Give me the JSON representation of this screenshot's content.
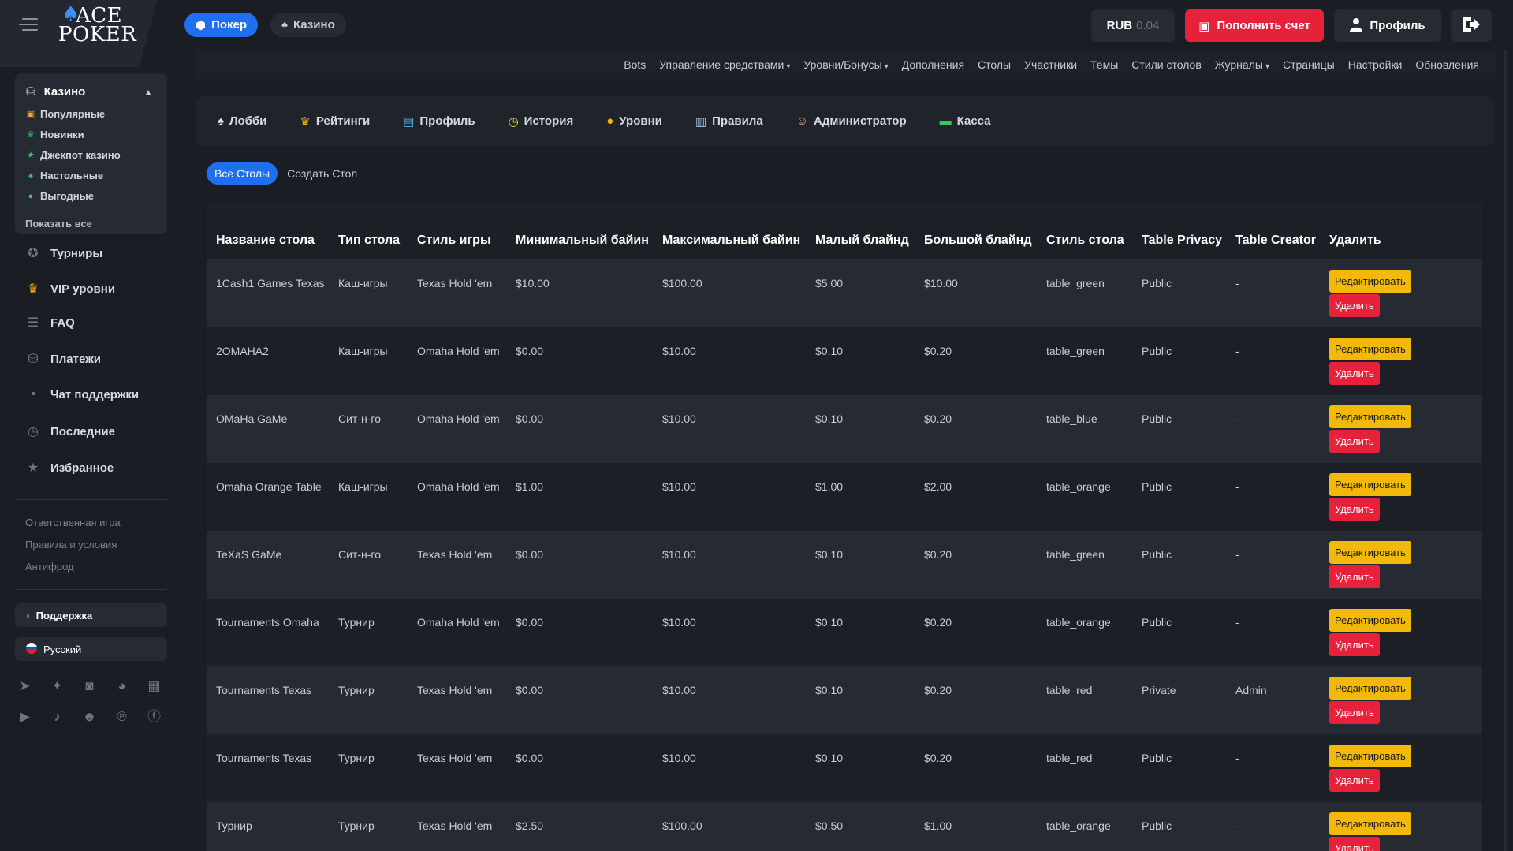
{
  "header": {
    "logo_line1": "ACE",
    "logo_line2": "POKER",
    "nav_poker": "Покер",
    "nav_casino": "Казино",
    "balance_currency": "RUB",
    "balance_amount": "0.04",
    "deposit_label": "Пополнить счет",
    "profile_label": "Профиль"
  },
  "admin_nav": [
    "Bots",
    "Управление средствами",
    "Уровни/Бонусы",
    "Дополнения",
    "Столы",
    "Участники",
    "Темы",
    "Стили столов",
    "Журналы",
    "Страницы",
    "Настройки",
    "Обновления"
  ],
  "sidebar": {
    "casino_title": "Казино",
    "casino_items": [
      {
        "label": "Популярные",
        "icon": "fire-icon",
        "color": "#f5a623"
      },
      {
        "label": "Новинки",
        "icon": "trophy-icon",
        "color": "#30c95a"
      },
      {
        "label": "Джекпот казино",
        "icon": "star-icon",
        "color": "#30c95a"
      },
      {
        "label": "Настольные",
        "icon": "spade-icon",
        "color": "#30c95a"
      },
      {
        "label": "Выгодные",
        "icon": "check-icon",
        "color": "#30c95a"
      }
    ],
    "show_all": "Показать все",
    "items": [
      {
        "label": "Турниры",
        "icon": "tournament-icon"
      },
      {
        "label": "VIP уровни",
        "icon": "crown-icon"
      },
      {
        "label": "FAQ",
        "icon": "faq-icon"
      },
      {
        "label": "Платежи",
        "icon": "money-bag-icon"
      },
      {
        "label": "Чат поддержки",
        "icon": "chat-icon"
      },
      {
        "label": "Последние",
        "icon": "recent-icon"
      },
      {
        "label": "Избранное",
        "icon": "star-icon"
      }
    ],
    "footer_links": [
      "Ответственная игра",
      "Правила и условия",
      "Антифрод"
    ],
    "support_label": "Поддержка",
    "language_label": "Русский"
  },
  "menu": [
    {
      "label": "Лобби",
      "icon": "lobby-icon"
    },
    {
      "label": "Рейтинги",
      "icon": "trophy-icon"
    },
    {
      "label": "Профиль",
      "icon": "profile-card-icon"
    },
    {
      "label": "История",
      "icon": "clock-icon"
    },
    {
      "label": "Уровни",
      "icon": "bulb-icon"
    },
    {
      "label": "Правила",
      "icon": "rules-icon"
    },
    {
      "label": "Администратор",
      "icon": "admin-icon"
    },
    {
      "label": "Касса",
      "icon": "cash-icon"
    }
  ],
  "tabs": {
    "all_tables": "Все Столы",
    "create_table": "Создать Стол"
  },
  "table": {
    "headers": [
      "Название стола",
      "Тип стола",
      "Стиль игры",
      "Минимальный байин",
      "Максимальный байин",
      "Малый блайнд",
      "Большой блайнд",
      "Стиль стола",
      "Table Privacy",
      "Table Creator",
      "Удалить"
    ],
    "edit_label": "Редактировать",
    "delete_label": "Удалить",
    "rows": [
      [
        "1Cash1 Games Texas",
        "Каш-игры",
        "Texas Hold 'em",
        "$10.00",
        "$100.00",
        "$5.00",
        "$10.00",
        "table_green",
        "Public",
        "-"
      ],
      [
        "2OMAHA2",
        "Каш-игры",
        "Omaha Hold 'em",
        "$0.00",
        "$10.00",
        "$0.10",
        "$0.20",
        "table_green",
        "Public",
        "-"
      ],
      [
        "OMaHa GaMe",
        "Сит-н-го",
        "Omaha Hold 'em",
        "$0.00",
        "$10.00",
        "$0.10",
        "$0.20",
        "table_blue",
        "Public",
        "-"
      ],
      [
        "Omaha Orange Table",
        "Каш-игры",
        "Omaha Hold 'em",
        "$1.00",
        "$10.00",
        "$1.00",
        "$2.00",
        "table_orange",
        "Public",
        "-"
      ],
      [
        "TeXaS GaMe",
        "Сит-н-го",
        "Texas Hold 'em",
        "$0.00",
        "$10.00",
        "$0.10",
        "$0.20",
        "table_green",
        "Public",
        "-"
      ],
      [
        "Tournaments Omaha",
        "Турнир",
        "Omaha Hold 'em",
        "$0.00",
        "$10.00",
        "$0.10",
        "$0.20",
        "table_orange",
        "Public",
        "-"
      ],
      [
        "Tournaments Texas",
        "Турнир",
        "Texas Hold 'em",
        "$0.00",
        "$10.00",
        "$0.10",
        "$0.20",
        "table_red",
        "Private",
        "Admin"
      ],
      [
        "Tournaments Texas",
        "Турнир",
        "Texas Hold 'em",
        "$0.00",
        "$10.00",
        "$0.10",
        "$0.20",
        "table_red",
        "Public",
        "-"
      ],
      [
        "Турнир",
        "Турнир",
        "Texas Hold 'em",
        "$2.50",
        "$100.00",
        "$0.50",
        "$1.00",
        "table_orange",
        "Public",
        "-"
      ]
    ]
  },
  "colors": {
    "accent_blue": "#1f6ff0",
    "danger_red": "#e8213a",
    "edit_yellow": "#f3b90a"
  }
}
